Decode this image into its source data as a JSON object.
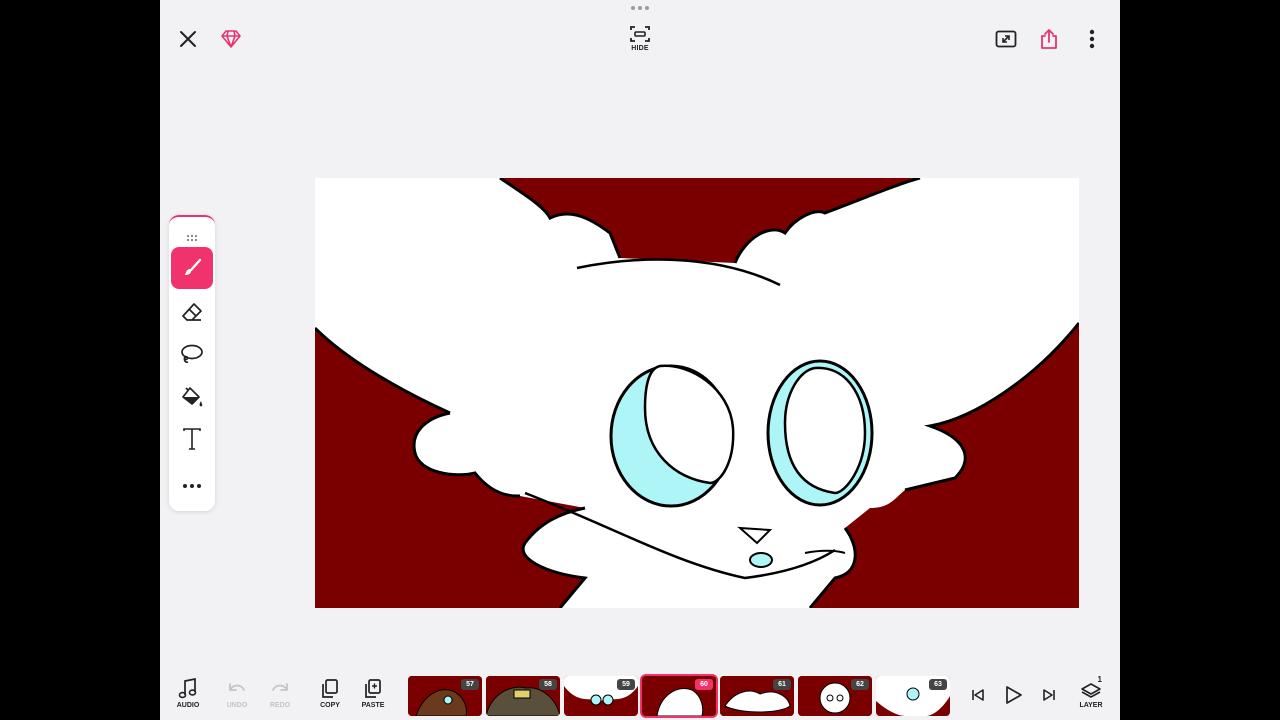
{
  "topbar": {
    "hide_label": "HIDE",
    "icons": [
      "close-icon",
      "diamond-icon",
      "hide-ui-icon",
      "resize-icon",
      "share-icon",
      "more-vertical-icon"
    ],
    "accent_color": "#f0336c"
  },
  "toolbar": {
    "tools": [
      {
        "name": "brush",
        "icon": "brush-icon",
        "active": true
      },
      {
        "name": "eraser",
        "icon": "eraser-icon",
        "active": false
      },
      {
        "name": "lasso",
        "icon": "lasso-icon",
        "active": false
      },
      {
        "name": "fill",
        "icon": "paint-bucket-icon",
        "active": false
      },
      {
        "name": "text",
        "icon": "text-icon",
        "active": false
      },
      {
        "name": "more",
        "icon": "more-horizontal-icon",
        "active": false
      }
    ]
  },
  "canvas": {
    "background_color": "#7a0000",
    "eye_color": "#aef5f7"
  },
  "bottombar": {
    "audio_label": "AUDIO",
    "undo_label": "UNDO",
    "redo_label": "REDO",
    "copy_label": "COPY",
    "paste_label": "PASTE",
    "layer_label": "LAYER",
    "layer_count": "1",
    "frames": [
      {
        "number": "57",
        "current": false
      },
      {
        "number": "58",
        "current": false
      },
      {
        "number": "59",
        "current": false
      },
      {
        "number": "60",
        "current": true
      },
      {
        "number": "61",
        "current": false
      },
      {
        "number": "62",
        "current": false
      },
      {
        "number": "63",
        "current": false
      }
    ]
  }
}
